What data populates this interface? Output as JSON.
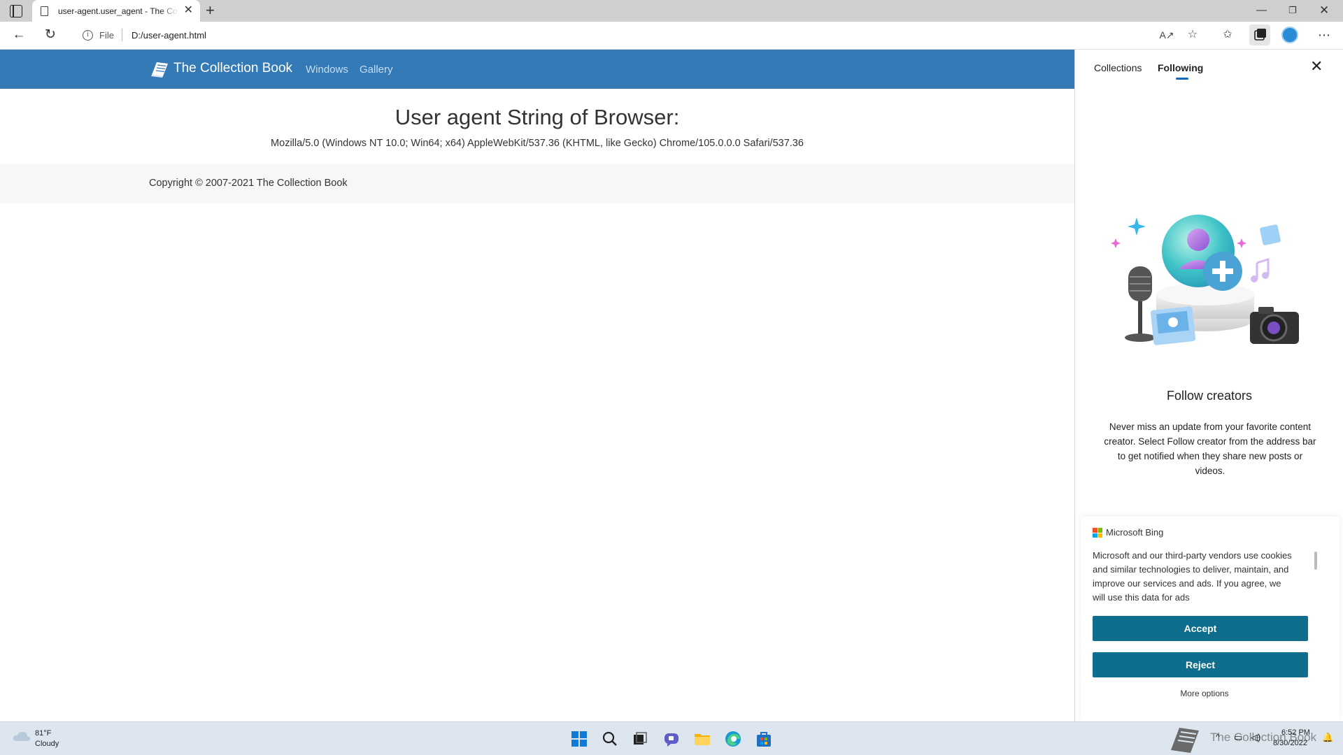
{
  "browser": {
    "tab_title": "user-agent.user_agent - The Collection Book",
    "address_scheme_label": "File",
    "address_url": "D:/user-agent.html"
  },
  "site": {
    "brand": "The Collection Book",
    "nav": [
      {
        "label": "Windows"
      },
      {
        "label": "Gallery"
      }
    ],
    "heading": "User agent String of Browser:",
    "user_agent": "Mozilla/5.0 (Windows NT 10.0; Win64; x64) AppleWebKit/537.36 (KHTML, like Gecko) Chrome/105.0.0.0 Safari/537.36",
    "copyright": "Copyright © 2007-2021 The Collection Book",
    "brand_color": "#337ab7"
  },
  "side_panel": {
    "tabs": [
      {
        "label": "Collections",
        "active": false
      },
      {
        "label": "Following",
        "active": true
      }
    ],
    "follow_title": "Follow creators",
    "follow_description": "Never miss an update from your favorite content creator. Select Follow creator from the address bar to get notified when they share new posts or videos.",
    "bing": {
      "name": "Microsoft Bing",
      "text": "Microsoft and our third-party vendors use cookies and similar technologies to deliver, maintain, and improve our services and ads. If you agree, we will use this data for ads",
      "accept_label": "Accept",
      "reject_label": "Reject",
      "more_options_label": "More options",
      "button_color": "#0f6e8e"
    }
  },
  "taskbar": {
    "weather_temp": "81°F",
    "weather_condition": "Cloudy",
    "time": "6:52 PM",
    "date": "8/30/2022",
    "watermark": "The Collection Book"
  }
}
